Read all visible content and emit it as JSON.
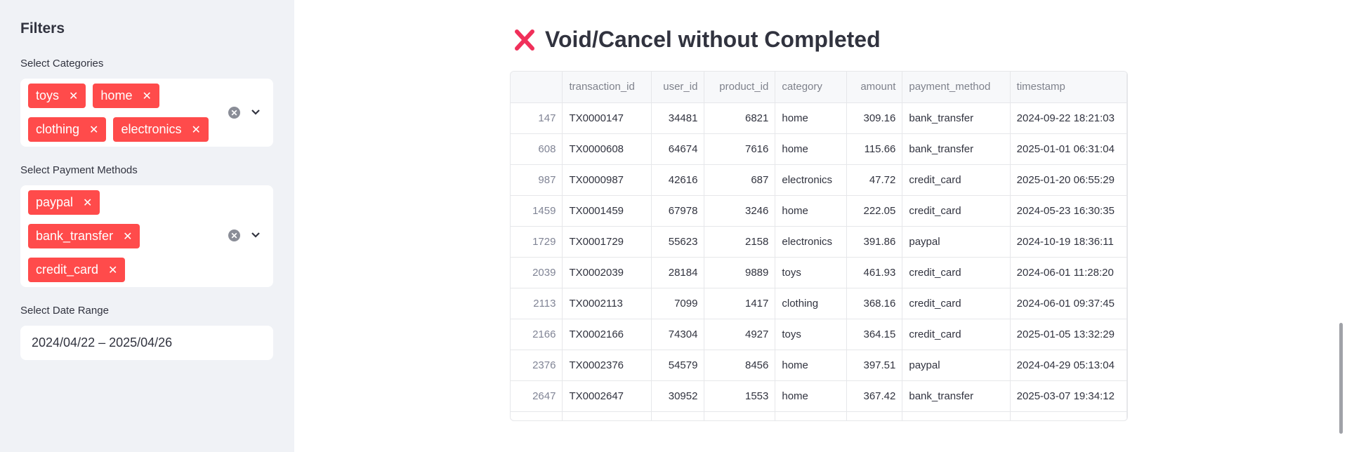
{
  "sidebar": {
    "title": "Filters",
    "categories": {
      "label": "Select Categories",
      "tags": [
        "toys",
        "home",
        "clothing",
        "electronics"
      ]
    },
    "payment": {
      "label": "Select Payment Methods",
      "tags": [
        "paypal",
        "bank_transfer",
        "credit_card"
      ]
    },
    "date": {
      "label": "Select Date Range",
      "value": "2024/04/22 – 2025/04/26"
    }
  },
  "main": {
    "title": "Void/Cancel without Completed",
    "columns": [
      "",
      "transaction_id",
      "user_id",
      "product_id",
      "category",
      "amount",
      "payment_method",
      "timestamp"
    ],
    "rows": [
      [
        "147",
        "TX0000147",
        "34481",
        "6821",
        "home",
        "309.16",
        "bank_transfer",
        "2024-09-22 18:21:03"
      ],
      [
        "608",
        "TX0000608",
        "64674",
        "7616",
        "home",
        "115.66",
        "bank_transfer",
        "2025-01-01 06:31:04"
      ],
      [
        "987",
        "TX0000987",
        "42616",
        "687",
        "electronics",
        "47.72",
        "credit_card",
        "2025-01-20 06:55:29"
      ],
      [
        "1459",
        "TX0001459",
        "67978",
        "3246",
        "home",
        "222.05",
        "credit_card",
        "2024-05-23 16:30:35"
      ],
      [
        "1729",
        "TX0001729",
        "55623",
        "2158",
        "electronics",
        "391.86",
        "paypal",
        "2024-10-19 18:36:11"
      ],
      [
        "2039",
        "TX0002039",
        "28184",
        "9889",
        "toys",
        "461.93",
        "credit_card",
        "2024-06-01 11:28:20"
      ],
      [
        "2113",
        "TX0002113",
        "7099",
        "1417",
        "clothing",
        "368.16",
        "credit_card",
        "2024-06-01 09:37:45"
      ],
      [
        "2166",
        "TX0002166",
        "74304",
        "4927",
        "toys",
        "364.15",
        "credit_card",
        "2025-01-05 13:32:29"
      ],
      [
        "2376",
        "TX0002376",
        "54579",
        "8456",
        "home",
        "397.51",
        "paypal",
        "2024-04-29 05:13:04"
      ],
      [
        "2647",
        "TX0002647",
        "30952",
        "1553",
        "home",
        "367.42",
        "bank_transfer",
        "2025-03-07 19:34:12"
      ]
    ]
  },
  "colors": {
    "accent": "#ff4b4b",
    "sidebar_bg": "#f0f2f6"
  }
}
